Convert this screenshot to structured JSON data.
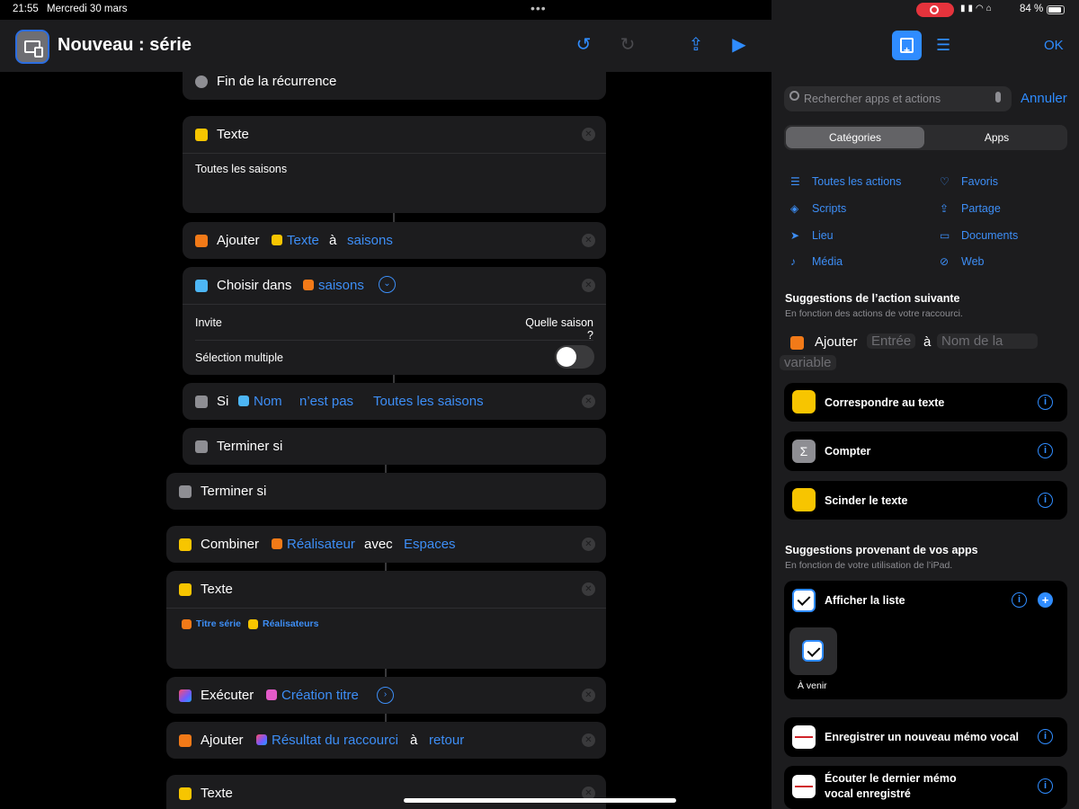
{
  "status": {
    "time": "21:55",
    "date": "Mercredi 30 mars",
    "battery": "84 %"
  },
  "editor": {
    "title": "Nouveau : série",
    "actions": {
      "end_repeat": "Fin de la récurrence",
      "text1": {
        "label": "Texte",
        "content": "Toutes les saisons"
      },
      "add1": {
        "label": "Ajouter",
        "token": "Texte",
        "to": "à",
        "var": "saisons"
      },
      "choose": {
        "label": "Choisir dans",
        "token": "saisons",
        "prompt_label": "Invite",
        "prompt_value": "Quelle saison ?",
        "multi_label": "Sélection multiple"
      },
      "if": {
        "label": "Si",
        "token": "Nom",
        "op": "n’est pas",
        "value": "Toutes les saisons"
      },
      "endif1": "Terminer si",
      "endif2": "Terminer si",
      "combine": {
        "label": "Combiner",
        "token": "Réalisateur",
        "with": "avec",
        "value": "Espaces"
      },
      "text2": {
        "label": "Texte",
        "tok1": "Titre série",
        "tok2": "Réalisateurs"
      },
      "run": {
        "label": "Exécuter",
        "token": "Création titre"
      },
      "add2": {
        "label": "Ajouter",
        "token": "Résultat du raccourci",
        "to": "à",
        "var": "retour"
      },
      "text3": {
        "label": "Texte"
      }
    }
  },
  "panel": {
    "ok": "OK",
    "search_placeholder": "Rechercher apps et actions",
    "cancel": "Annuler",
    "seg": {
      "categories": "Catégories",
      "apps": "Apps"
    },
    "categories": {
      "all": "Toutes les actions",
      "favs": "Favoris",
      "scripts": "Scripts",
      "share": "Partage",
      "location": "Lieu",
      "documents": "Documents",
      "media": "Média",
      "web": "Web"
    },
    "next_suggestions": {
      "title": "Suggestions de l’action suivante",
      "subtitle": "En fonction des actions de votre raccourci.",
      "row": {
        "action": "Ajouter",
        "input": "Entrée",
        "to": "à",
        "var1": "Nom de la",
        "var2": "variable"
      },
      "items": [
        "Correspondre au texte",
        "Compter",
        "Scinder le texte"
      ]
    },
    "app_suggestions": {
      "title": "Suggestions provenant de vos apps",
      "subtitle": "En fonction de votre utilisation de l’iPad.",
      "show_list": "Afficher la liste",
      "upcoming": "À venir",
      "voice1": "Enregistrer un nouveau mémo vocal",
      "voice2_line1": "Écouter le dernier mémo",
      "voice2_line2": "vocal enregistré"
    }
  }
}
